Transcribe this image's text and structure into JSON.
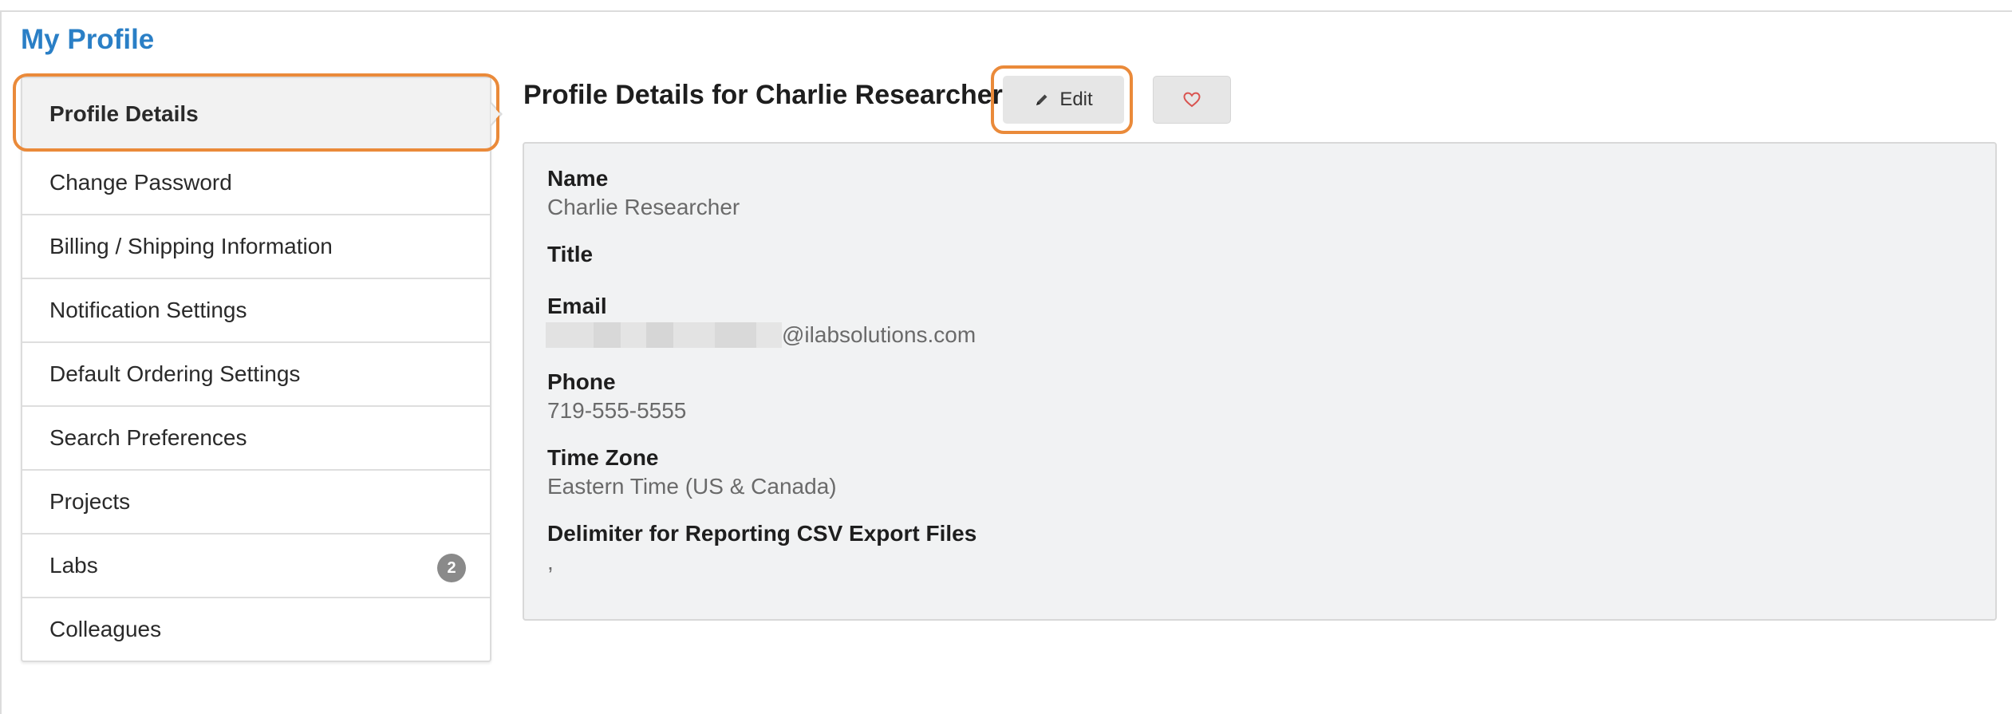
{
  "page": {
    "title": "My Profile"
  },
  "sidebar": {
    "items": [
      {
        "label": "Profile Details",
        "active": true
      },
      {
        "label": "Change Password"
      },
      {
        "label": "Billing / Shipping Information"
      },
      {
        "label": "Notification Settings"
      },
      {
        "label": "Default Ordering Settings"
      },
      {
        "label": "Search Preferences"
      },
      {
        "label": "Projects"
      },
      {
        "label": "Labs",
        "badge": "2"
      },
      {
        "label": "Colleagues"
      }
    ]
  },
  "main": {
    "heading": "Profile Details for Charlie Researcher",
    "edit_label": "Edit",
    "fields": [
      {
        "label": "Name",
        "value": "Charlie Researcher"
      },
      {
        "label": "Title",
        "value": ""
      },
      {
        "label": "Email",
        "value": "@ilabsolutions.com"
      },
      {
        "label": "Phone",
        "value": "719-555-5555"
      },
      {
        "label": "Time Zone",
        "value": "Eastern Time (US & Canada)"
      },
      {
        "label": "Delimiter for Reporting CSV Export Files",
        "value": ","
      }
    ]
  },
  "colors": {
    "accent": "#2a7fc6",
    "highlight": "#ea8a3a",
    "favorite_icon": "#d9534f"
  },
  "icons": {
    "edit": "pencil-icon",
    "favorite": "heart-icon"
  }
}
